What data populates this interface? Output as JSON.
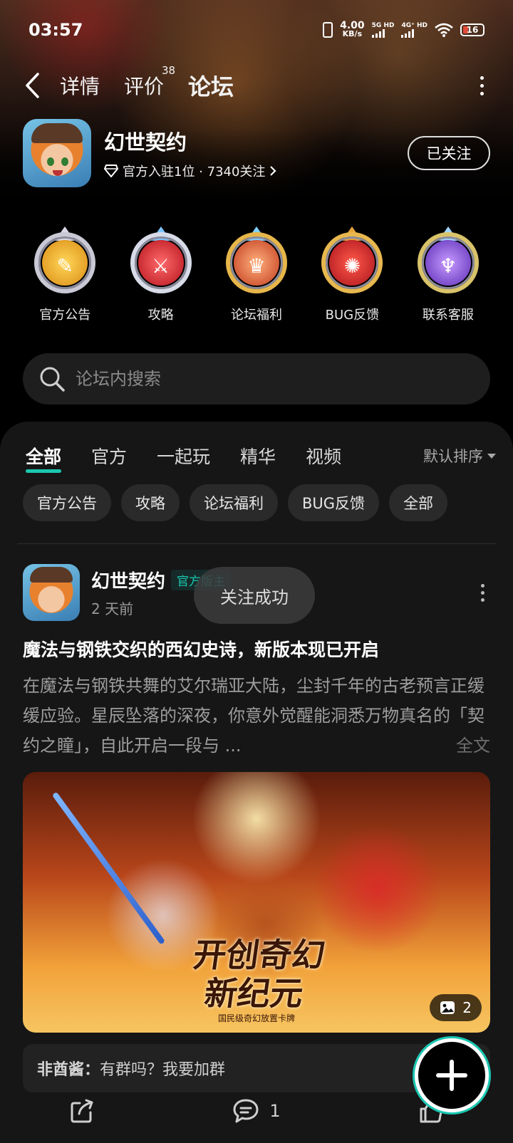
{
  "status": {
    "time": "03:57",
    "net_speed_value": "4.00",
    "net_speed_unit": "KB/s",
    "sim1": "5G HD",
    "sim2": "4G⁺ HD",
    "battery": "16"
  },
  "nav": {
    "tabs": [
      {
        "label": "详情"
      },
      {
        "label": "评价",
        "badge": "38"
      },
      {
        "label": "论坛"
      }
    ]
  },
  "app": {
    "name": "幻世契约",
    "subtitle": "官方入驻1位 · 7340关注",
    "follow_label": "已关注"
  },
  "categories": [
    {
      "label": "官方公告",
      "color": "#e7a426"
    },
    {
      "label": "攻略",
      "color": "#d0343a"
    },
    {
      "label": "论坛福利",
      "color": "#d2482b"
    },
    {
      "label": "BUG反馈",
      "color": "#cf2f2b"
    },
    {
      "label": "联系客服",
      "color": "#8b56d6"
    }
  ],
  "search": {
    "placeholder": "论坛内搜索"
  },
  "filters": {
    "tabs": [
      {
        "label": "全部"
      },
      {
        "label": "官方"
      },
      {
        "label": "一起玩"
      },
      {
        "label": "精华"
      },
      {
        "label": "视频"
      }
    ],
    "sort_label": "默认排序",
    "chips": [
      {
        "label": "官方公告"
      },
      {
        "label": "攻略"
      },
      {
        "label": "论坛福利"
      },
      {
        "label": "BUG反馈"
      },
      {
        "label": "全部"
      }
    ]
  },
  "post": {
    "author": "幻世契约",
    "role": "官方版主",
    "time": "2 天前",
    "toast": "关注成功",
    "title": "魔法与钢铁交织的西幻史诗，新版本现已开启",
    "body": "在魔法与钢铁共舞的艾尔瑞亚大陆，尘封千年的古老预言正缓缓应验。星辰坠落的深夜，你意外觉醒能洞悉万物真名的「契约之瞳」，自此开启一段与 ...",
    "full_text_link": "全文",
    "image_title_line1": "开创奇幻",
    "image_title_line2": "新纪元",
    "image_subtitle": "国民级奇幻放置卡牌",
    "image_count": "2",
    "comment_user": "非酋酱：",
    "comment_text": "有群吗？我要加群",
    "comment_count": "1"
  },
  "colors": {
    "accent": "#1ac7b1",
    "background": "#000000",
    "sheet": "#161616"
  }
}
